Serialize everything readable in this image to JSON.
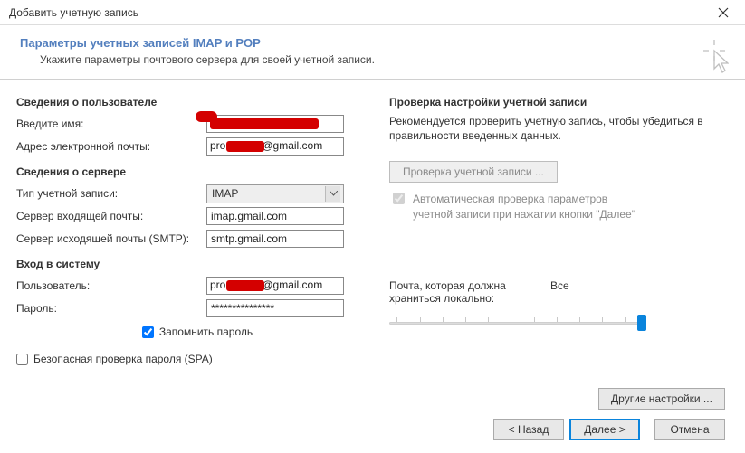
{
  "window": {
    "title": "Добавить учетную запись"
  },
  "header": {
    "title": "Параметры учетных записей IMAP и POP",
    "subtitle": "Укажите параметры почтового сервера для своей учетной записи."
  },
  "left": {
    "user_section": "Сведения о пользователе",
    "name_label": "Введите имя:",
    "name_value": "",
    "email_label": "Адрес электронной почты:",
    "email_visible_prefix": "pro",
    "email_visible_suffix": "@gmail.com",
    "server_section": "Сведения о сервере",
    "acct_type_label": "Тип учетной записи:",
    "acct_type_value": "IMAP",
    "inbox_label": "Сервер входящей почты:",
    "inbox_value": "imap.gmail.com",
    "outbox_label": "Сервер исходящей почты (SMTP):",
    "outbox_value": "smtp.gmail.com",
    "login_section": "Вход в систему",
    "user_label": "Пользователь:",
    "user_visible_prefix": "pro",
    "user_visible_suffix": "@gmail.com",
    "pwd_label": "Пароль:",
    "pwd_value": "***************",
    "remember_label": "Запомнить пароль",
    "spa_label": "Безопасная проверка пароля (SPA)"
  },
  "right": {
    "title": "Проверка настройки учетной записи",
    "desc": "Рекомендуется проверить учетную запись, чтобы убедиться в правильности введенных данных.",
    "test_btn": "Проверка учетной записи ...",
    "auto_test": "Автоматическая проверка параметров учетной записи при нажатии кнопки \"Далее\"",
    "slider_label_left": "Почта, которая должна храниться локально:",
    "slider_label_right": "Все",
    "other_settings": "Другие настройки ..."
  },
  "footer": {
    "back": "< Назад",
    "next": "Далее >",
    "cancel": "Отмена"
  }
}
